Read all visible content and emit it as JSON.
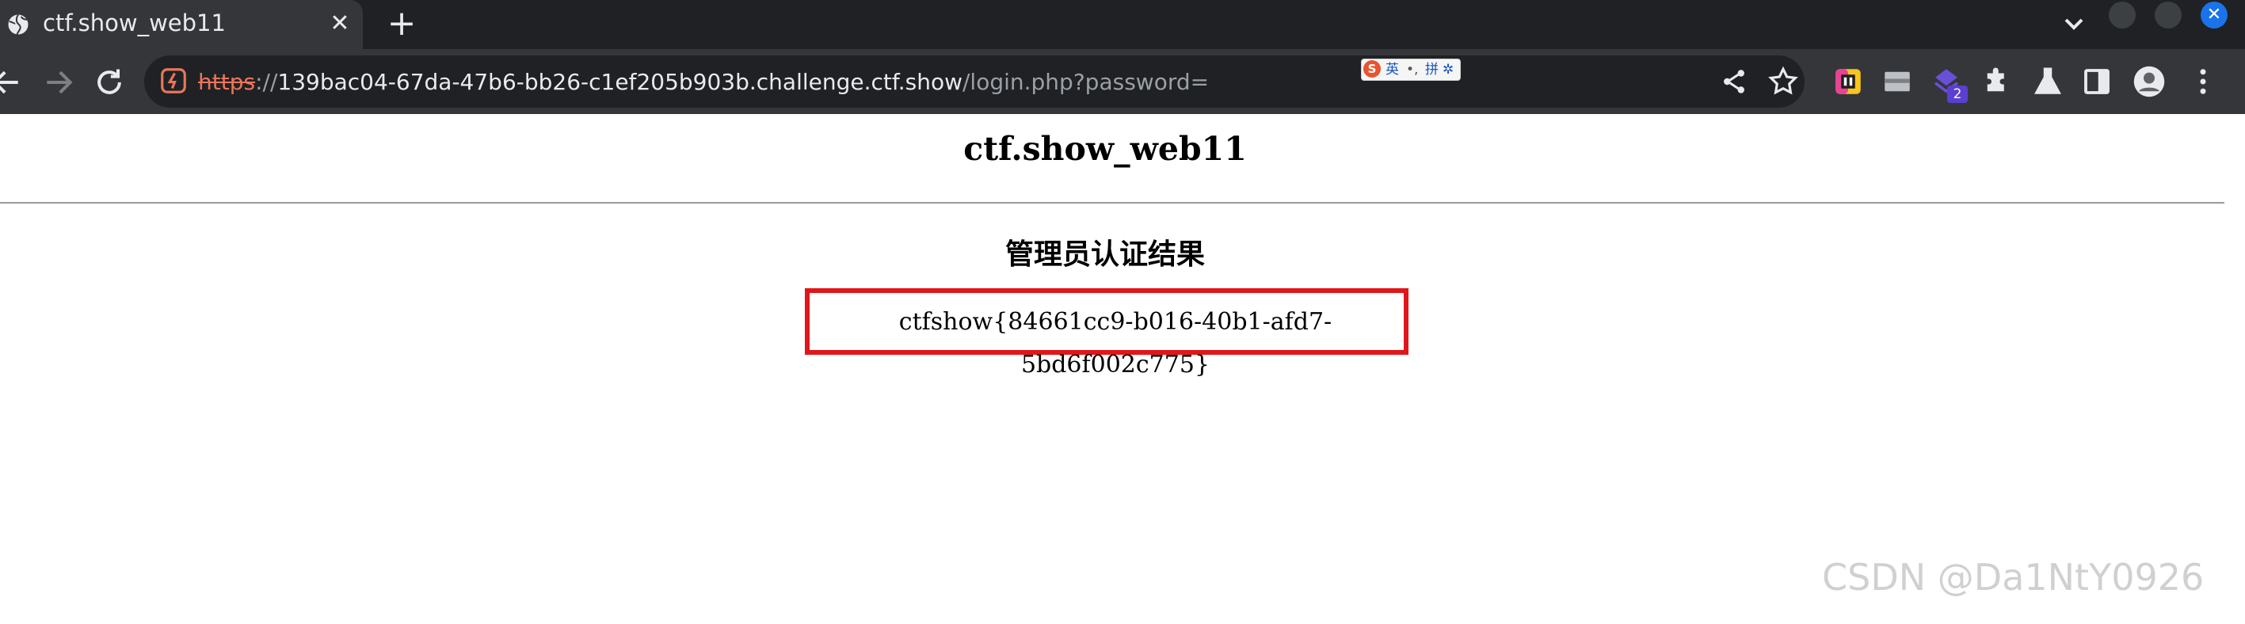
{
  "browser": {
    "tab": {
      "title": "ctf.show_web11",
      "close_glyph": "✕"
    },
    "new_tab_glyph": "+",
    "address": {
      "scheme": "https",
      "separator": "://",
      "host": "139bac04-67da-47b6-bb26-c1ef205b903b.challenge.ctf.show",
      "path": "/login.php?password="
    },
    "ime": {
      "logo": "S",
      "lang": "英",
      "punct": "•,",
      "mode": "拼",
      "settings": "✲"
    },
    "extension_badge": "2",
    "window_close_glyph": "✕"
  },
  "page": {
    "title": "ctf.show_web11",
    "section_title": "管理员认证结果",
    "result": "ctfshow{84661cc9-b016-40b1-afd7-5bd6f002c775}"
  },
  "watermark": "CSDN @Da1NtY0926",
  "colors": {
    "tabbar_bg": "#202124",
    "toolbar_bg": "#35363a",
    "highlight_border": "#e0161a",
    "scheme_strike": "#e8765a"
  },
  "icons": {
    "tab_favicon": "globe-icon",
    "close": "close-icon",
    "new_tab": "plus-icon",
    "tab_search": "chevron-down-icon",
    "back": "back-arrow-icon",
    "forward": "forward-arrow-icon",
    "reload": "reload-icon",
    "security": "not-secure-icon",
    "share": "share-icon",
    "bookmark": "star-icon",
    "extensions": [
      "colorful-extension-icon",
      "reader-mode-icon",
      "extension-badge-icon",
      "puzzle-icon",
      "labs-flask-icon",
      "side-panel-icon"
    ],
    "profile": "avatar-icon",
    "menu": "kebab-menu-icon"
  }
}
